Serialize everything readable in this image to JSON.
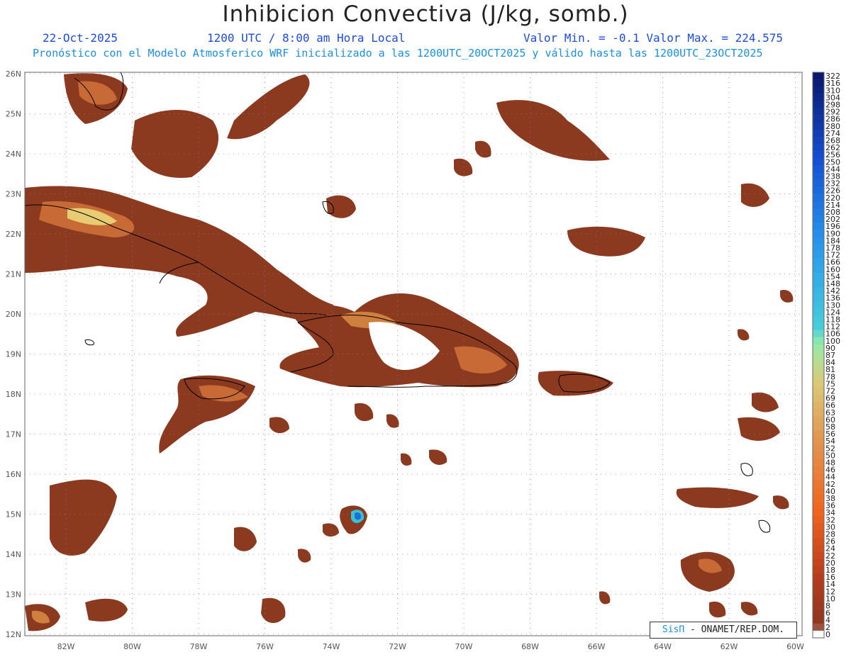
{
  "header": {
    "title": "Inhibicion Convectiva (J/kg, somb.)",
    "date": "22-Oct-2025",
    "time": "1200 UTC / 8:00 am Hora Local",
    "minmax": "Valor Min. = -0.1  Valor Max. = 224.575",
    "forecast": "Pronóstico con el Modelo Atmosferico WRF inicializado a las 1200UTC_20OCT2025 y válido hasta las  1200UTC_23OCT2025"
  },
  "credit": {
    "logo": "SisΠ",
    "text": " - ONAMET/REP.DOM."
  },
  "axes": {
    "lon_labels": [
      "82W",
      "80W",
      "78W",
      "76W",
      "74W",
      "72W",
      "70W",
      "68W",
      "66W",
      "64W",
      "62W",
      "60W"
    ],
    "lat_labels": [
      "12N",
      "13N",
      "14N",
      "15N",
      "16N",
      "17N",
      "18N",
      "19N",
      "20N",
      "21N",
      "22N",
      "23N",
      "24N",
      "25N",
      "26N"
    ]
  },
  "colorbar": {
    "labels": [
      "322",
      "316",
      "310",
      "304",
      "298",
      "292",
      "286",
      "280",
      "274",
      "268",
      "262",
      "256",
      "250",
      "244",
      "238",
      "232",
      "226",
      "220",
      "214",
      "208",
      "202",
      "196",
      "190",
      "184",
      "178",
      "172",
      "166",
      "160",
      "154",
      "148",
      "142",
      "136",
      "130",
      "124",
      "118",
      "112",
      "106",
      "100",
      "90",
      "87",
      "84",
      "81",
      "78",
      "75",
      "72",
      "69",
      "66",
      "63",
      "60",
      "58",
      "56",
      "54",
      "52",
      "50",
      "48",
      "46",
      "44",
      "42",
      "40",
      "38",
      "36",
      "34",
      "32",
      "30",
      "28",
      "26",
      "24",
      "22",
      "20",
      "18",
      "16",
      "14",
      "12",
      "10",
      "8",
      "6",
      "4",
      "2",
      "0"
    ]
  },
  "colors": {
    "field": "#8b3a1f",
    "field_mid": "#b0502a",
    "high": "#e6c86e",
    "peak": "#1c8fd6"
  }
}
